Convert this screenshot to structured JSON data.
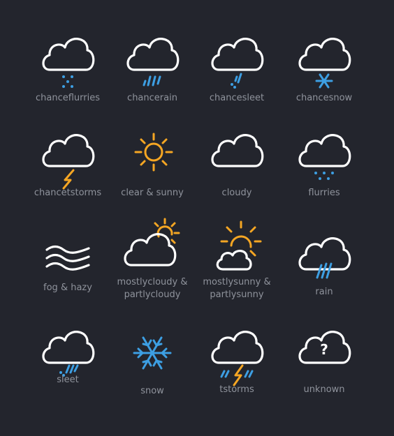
{
  "colors": {
    "background": "#23252d",
    "icon_white": "#ffffff",
    "icon_blue": "#3d9fe3",
    "icon_orange": "#f5a623",
    "label": "#8f939c"
  },
  "icons": [
    {
      "name": "chanceflurries-icon",
      "label": "chanceflurries"
    },
    {
      "name": "chancerain-icon",
      "label": "chancerain"
    },
    {
      "name": "chancesleet-icon",
      "label": "chancesleet"
    },
    {
      "name": "chancesnow-icon",
      "label": "chancesnow"
    },
    {
      "name": "chancetstorms-icon",
      "label": "chancetstorms"
    },
    {
      "name": "clear-sunny-icon",
      "label": "clear & sunny"
    },
    {
      "name": "cloudy-icon",
      "label": "cloudy"
    },
    {
      "name": "flurries-icon",
      "label": "flurries"
    },
    {
      "name": "fog-hazy-icon",
      "label": "fog & hazy"
    },
    {
      "name": "mostlycloudy-icon",
      "label": "mostlycloudy &",
      "label2": "partlycloudy"
    },
    {
      "name": "mostlysunny-icon",
      "label": "mostlysunny &",
      "label2": "partlysunny"
    },
    {
      "name": "rain-icon",
      "label": "rain"
    },
    {
      "name": "sleet-icon",
      "label": "sleet"
    },
    {
      "name": "snow-icon",
      "label": "snow"
    },
    {
      "name": "tstorms-icon",
      "label": "tstorms"
    },
    {
      "name": "unknown-icon",
      "label": "unknown"
    }
  ]
}
